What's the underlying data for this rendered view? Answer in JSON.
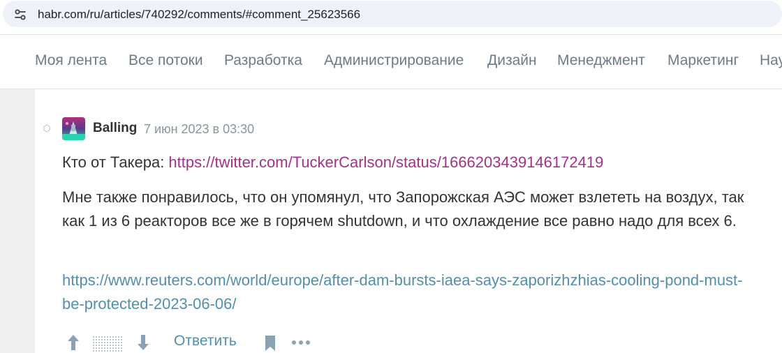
{
  "browser": {
    "url": "habr.com/ru/articles/740292/comments/#comment_25623566",
    "site_info_icon": "tune-icon"
  },
  "nav": {
    "items": [
      {
        "label": "Моя лента"
      },
      {
        "label": "Все потоки"
      },
      {
        "label": "Разработка"
      },
      {
        "label": "Администрирование"
      },
      {
        "label": "Дизайн"
      },
      {
        "label": "Менеджмент"
      },
      {
        "label": "Маркетинг"
      },
      {
        "label": "Нау"
      }
    ]
  },
  "comment": {
    "username": "Balling",
    "timestamp": "7 июн 2023 в 03:30",
    "p1_prefix": "Кто от Такера: ",
    "p1_link": "https://twitter.com/TuckerCarlson/status/1666203439146172419",
    "p2": "Мне также понравилось, что он упомянул, что Запорожская АЭС может взлететь на воздух, так как 1 из 6 реакторов все же в горячем shutdown, и что охлаждение все равно надо для всех 6.",
    "p3_link": "https://www.reuters.com/world/europe/after-dam-bursts-iaea-says-zaporizhzhias-cooling-pond-must-be-protected-2023-06-06/"
  },
  "actions": {
    "upvote_icon": "arrow-up-icon",
    "score_icon": "hidden-score-icon",
    "downvote_icon": "arrow-down-icon",
    "reply_label": "Ответить",
    "bookmark_icon": "bookmark-icon",
    "more_icon": "more-dots-icon"
  },
  "colors": {
    "link_magenta": "#a33185",
    "link_blue": "#548eaa",
    "nav_text": "#6d7b85",
    "text": "#333333"
  }
}
